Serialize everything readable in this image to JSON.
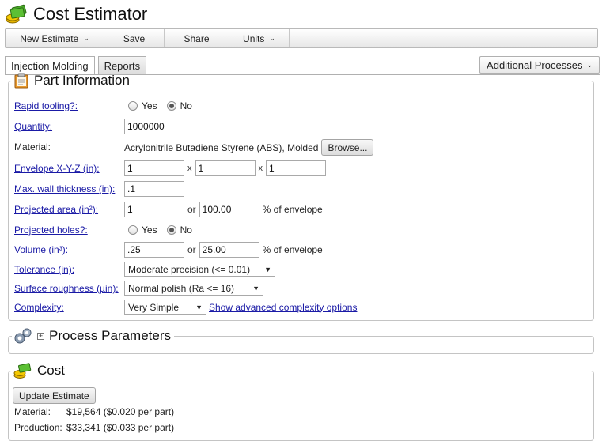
{
  "app": {
    "title": "Cost Estimator"
  },
  "toolbar": {
    "new_estimate": "New Estimate",
    "save": "Save",
    "share": "Share",
    "units": "Units"
  },
  "tabs": [
    {
      "label": "Injection Molding",
      "active": true
    },
    {
      "label": "Reports",
      "active": false
    }
  ],
  "additional_processes": "Additional Processes",
  "part_info": {
    "title": "Part Information",
    "rapid_tooling": {
      "label": "Rapid tooling?:",
      "yes": "Yes",
      "no": "No",
      "selected": "No"
    },
    "quantity": {
      "label": "Quantity:",
      "value": "1000000"
    },
    "material": {
      "label": "Material:",
      "value": "Acrylonitrile Butadiene Styrene (ABS), Molded",
      "browse": "Browse..."
    },
    "envelope": {
      "label": "Envelope X-Y-Z (in):",
      "x": "1",
      "y": "1",
      "z": "1",
      "sep": "x"
    },
    "wall": {
      "label": "Max. wall thickness (in):",
      "value": ".1"
    },
    "projected_area": {
      "label": "Projected area (in²):",
      "value": "1",
      "or": "or",
      "pct": "100.00",
      "suffix": "% of envelope"
    },
    "projected_holes": {
      "label": "Projected holes?:",
      "yes": "Yes",
      "no": "No",
      "selected": "No"
    },
    "volume": {
      "label": "Volume (in³):",
      "value": ".25",
      "or": "or",
      "pct": "25.00",
      "suffix": "% of envelope"
    },
    "tolerance": {
      "label": "Tolerance (in):",
      "value": "Moderate precision (<= 0.01)"
    },
    "roughness": {
      "label": "Surface roughness (µin):",
      "value": "Normal polish (Ra <= 16)"
    },
    "complexity": {
      "label": "Complexity:",
      "value": "Very Simple",
      "advanced_link": "Show advanced complexity options"
    }
  },
  "process_params": {
    "title": "Process Parameters",
    "expand": "+"
  },
  "cost": {
    "title": "Cost",
    "update_button": "Update Estimate",
    "lines": [
      {
        "label": "Material:",
        "value": "$19,564 ($0.020 per part)"
      },
      {
        "label": "Production:",
        "value": "$33,341 ($0.033 per part)"
      }
    ]
  }
}
